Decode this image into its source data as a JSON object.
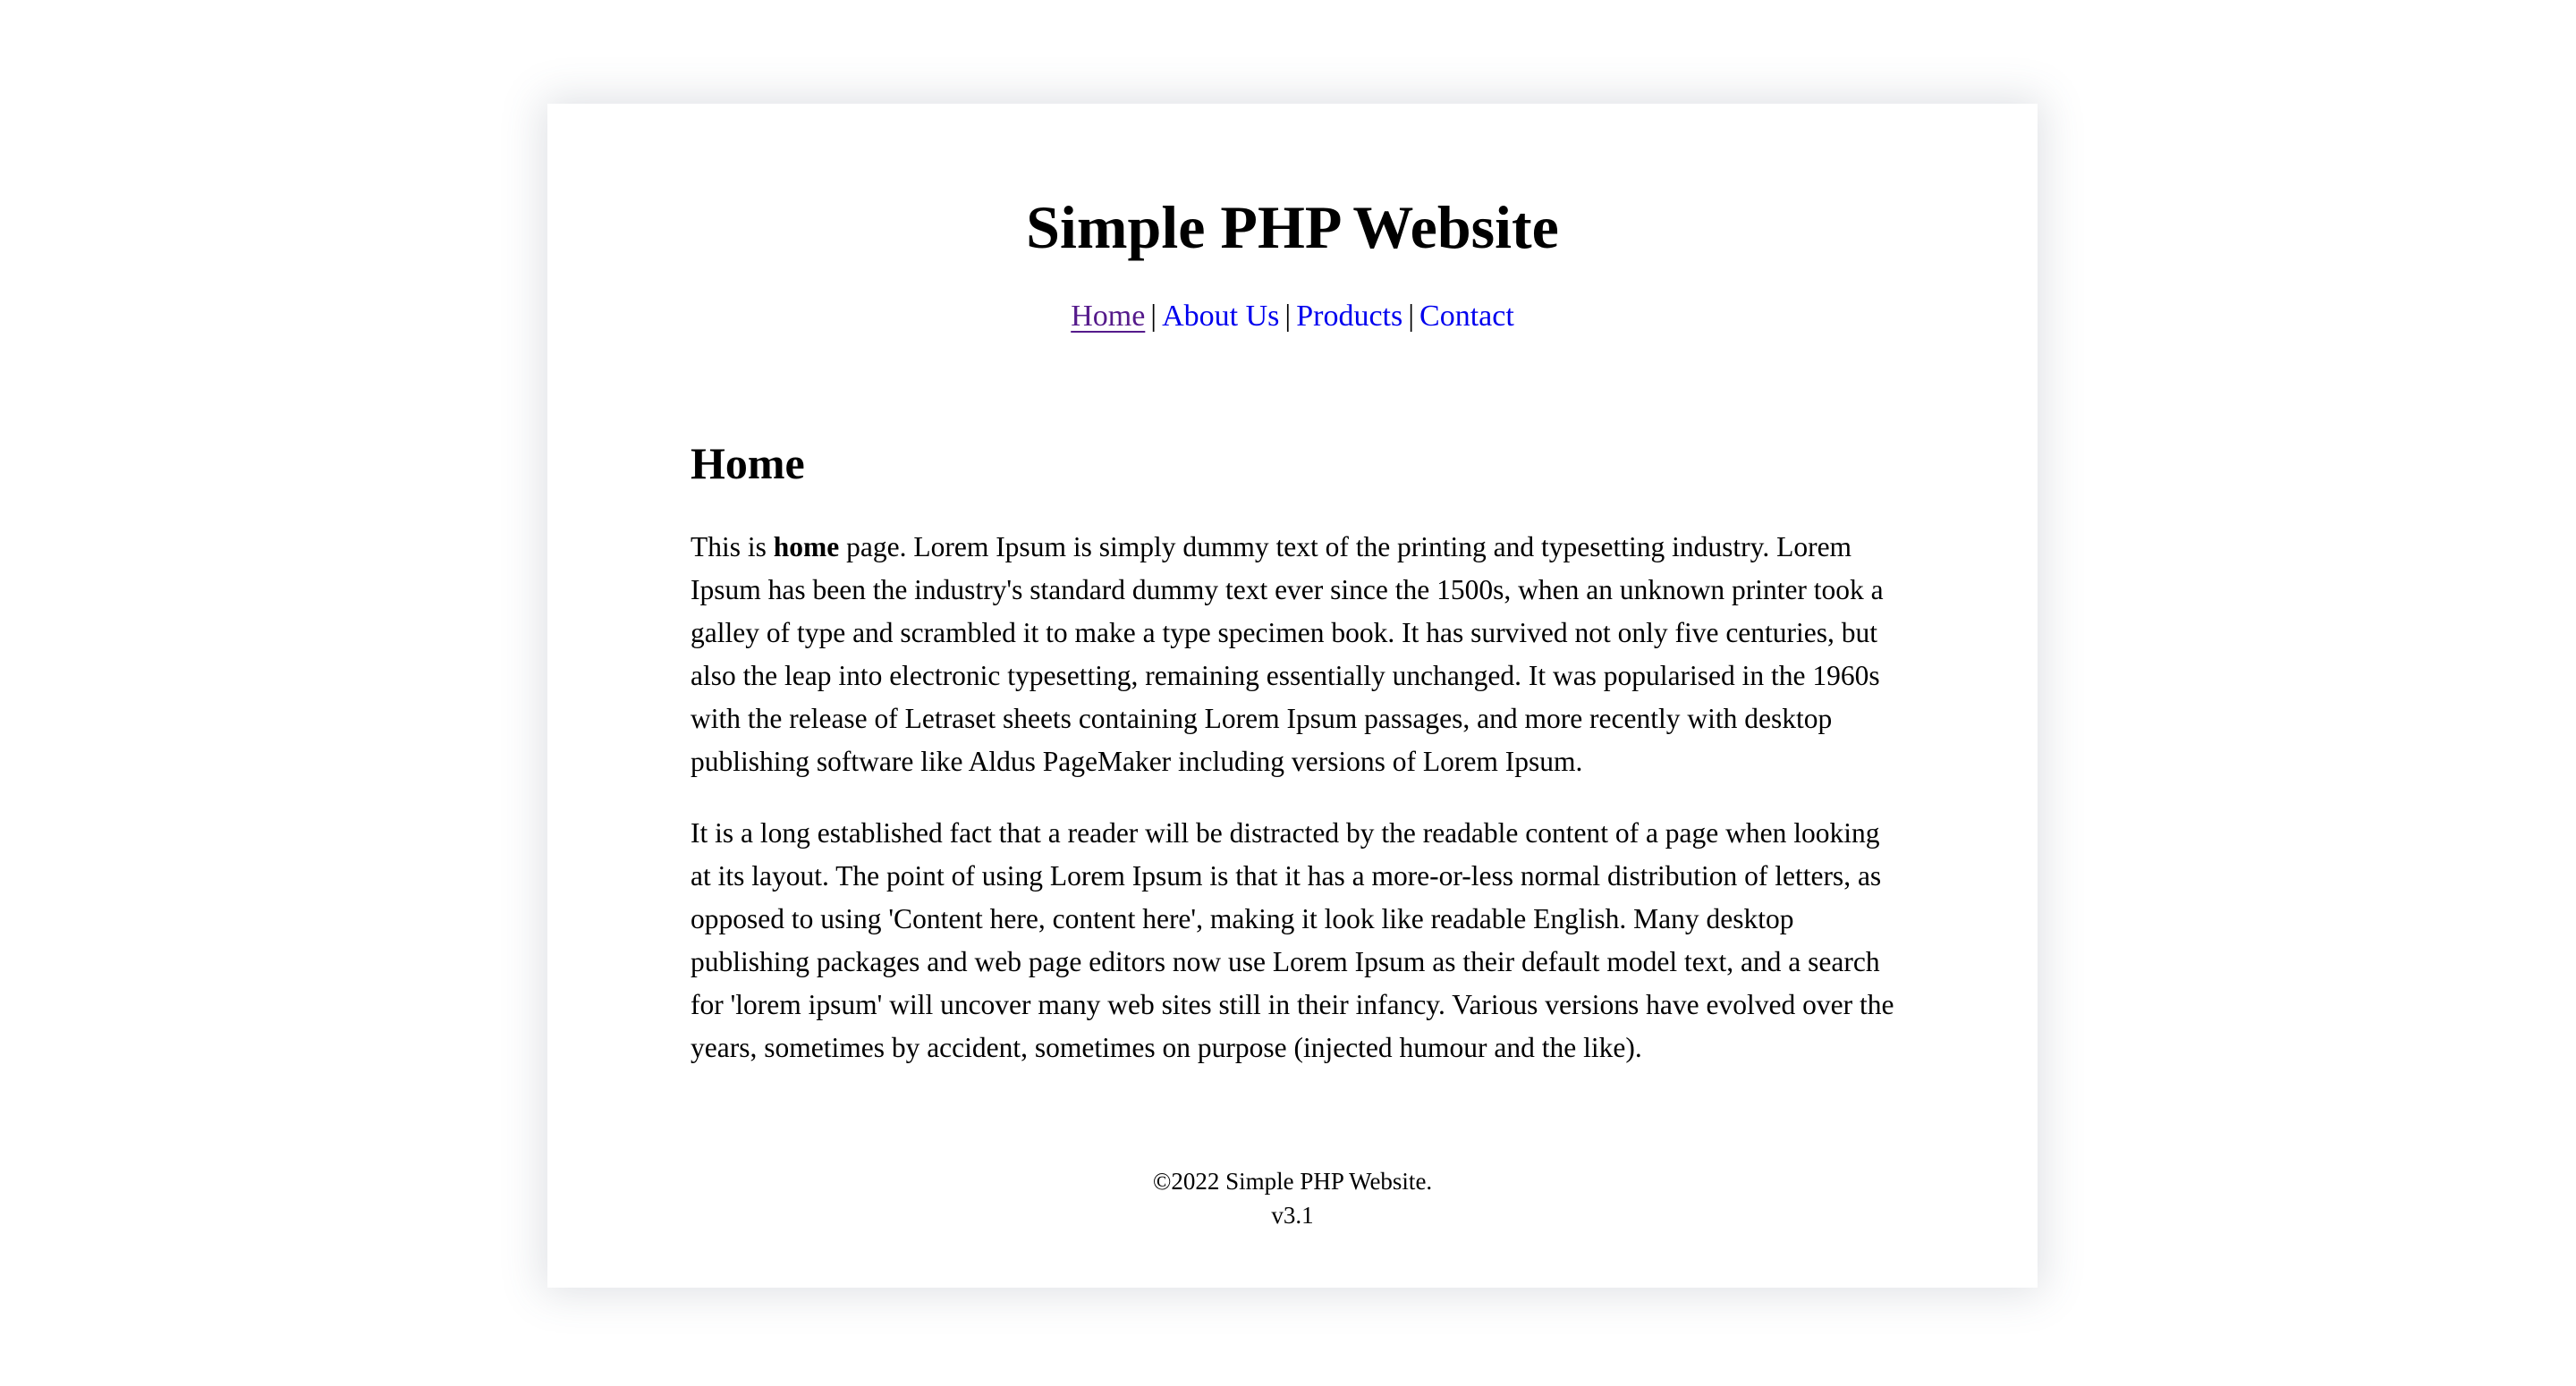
{
  "site": {
    "title": "Simple PHP Website"
  },
  "nav": {
    "items": [
      {
        "label": "Home",
        "active": true
      },
      {
        "label": "About Us",
        "active": false
      },
      {
        "label": "Products",
        "active": false
      },
      {
        "label": "Contact",
        "active": false
      }
    ],
    "separator": "|"
  },
  "main": {
    "heading": "Home",
    "paragraph1": {
      "prefix": "This is ",
      "bold": "home",
      "rest": " page. Lorem Ipsum is simply dummy text of the printing and typesetting industry. Lorem Ipsum has been the industry's standard dummy text ever since the 1500s, when an unknown printer took a galley of type and scrambled it to make a type specimen book. It has survived not only five centuries, but also the leap into electronic typesetting, remaining essentially unchanged. It was popularised in the 1960s with the release of Letraset sheets containing Lorem Ipsum passages, and more recently with desktop publishing software like Aldus PageMaker including versions of Lorem Ipsum."
    },
    "paragraph2": "It is a long established fact that a reader will be distracted by the readable content of a page when looking at its layout. The point of using Lorem Ipsum is that it has a more-or-less normal distribution of letters, as opposed to using 'Content here, content here', making it look like readable English. Many desktop publishing packages and web page editors now use Lorem Ipsum as their default model text, and a search for 'lorem ipsum' will uncover many web sites still in their infancy. Various versions have evolved over the years, sometimes by accident, sometimes on purpose (injected humour and the like)."
  },
  "footer": {
    "copyright": "©2022 Simple PHP Website.",
    "version": "v3.1"
  },
  "colors": {
    "link": "#0000ee",
    "visited_link": "#551a8b",
    "text": "#000000",
    "background": "#ffffff"
  }
}
